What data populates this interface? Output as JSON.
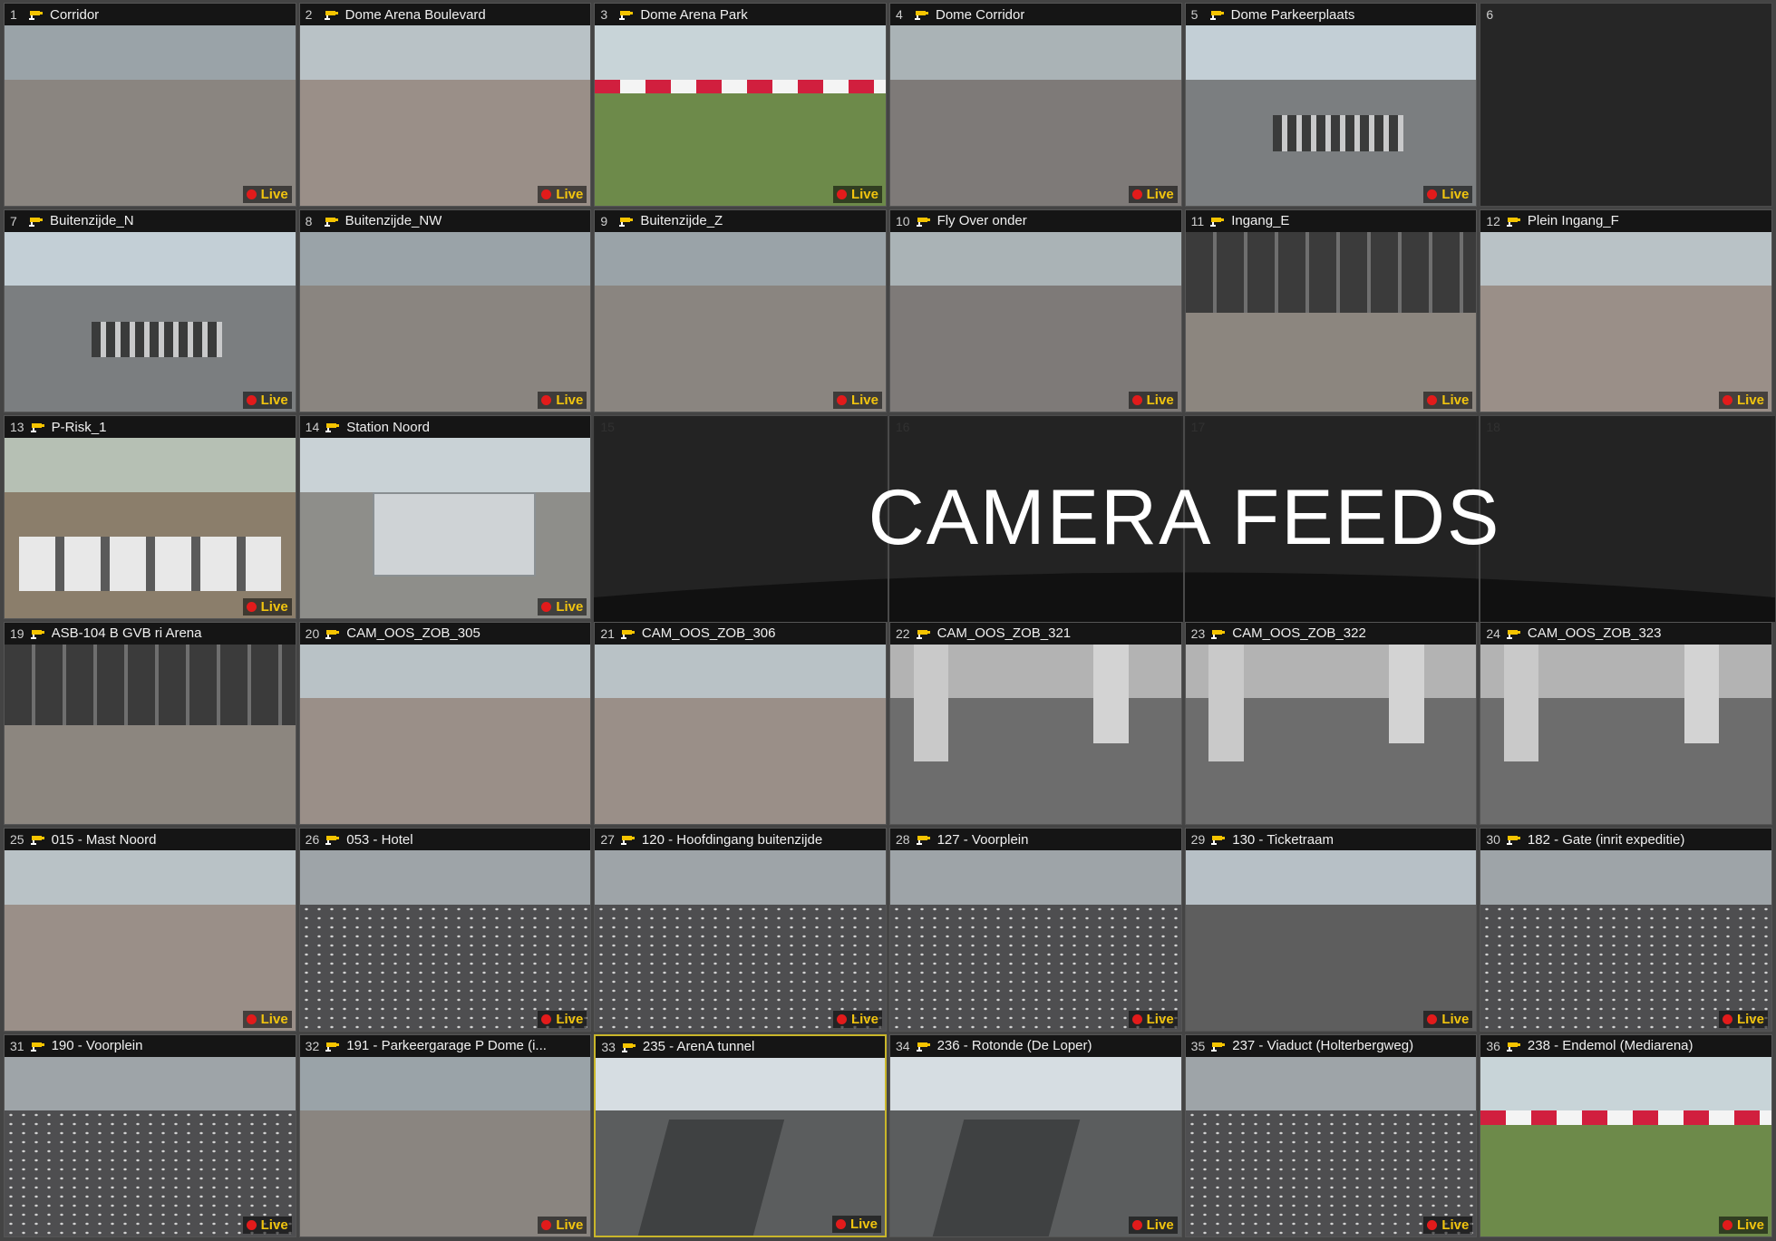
{
  "live_label": "Live",
  "colors": {
    "live_dot": "#e21b1b",
    "live_text": "#f1c40f",
    "selected_border": "#c9b62a"
  },
  "overlay_title": "CAMERA FEEDS",
  "tiles": [
    {
      "num": "1",
      "name": "Corridor",
      "live": true,
      "scene": "concrete"
    },
    {
      "num": "2",
      "name": "Dome Arena Boulevard",
      "live": true,
      "scene": "plaza"
    },
    {
      "num": "3",
      "name": "Dome Arena Park",
      "live": true,
      "scene": "park"
    },
    {
      "num": "4",
      "name": "Dome Corridor",
      "live": true,
      "scene": "walkway"
    },
    {
      "num": "5",
      "name": "Dome Parkeerplaats",
      "live": true,
      "scene": "parking"
    },
    {
      "num": "6",
      "name": "",
      "live": false,
      "scene": "empty"
    },
    {
      "num": "7",
      "name": "Buitenzijde_N",
      "live": true,
      "scene": "parking"
    },
    {
      "num": "8",
      "name": "Buitenzijde_NW",
      "live": true,
      "scene": "concrete"
    },
    {
      "num": "9",
      "name": "Buitenzijde_Z",
      "live": true,
      "scene": "concrete"
    },
    {
      "num": "10",
      "name": "Fly Over onder",
      "live": true,
      "scene": "walkway"
    },
    {
      "num": "11",
      "name": "Ingang_E",
      "live": true,
      "scene": "entrance"
    },
    {
      "num": "12",
      "name": "Plein Ingang_F",
      "live": true,
      "scene": "plaza"
    },
    {
      "num": "13",
      "name": "P-Risk_1",
      "live": true,
      "scene": "buses"
    },
    {
      "num": "14",
      "name": "Station Noord",
      "live": true,
      "scene": "station"
    },
    {
      "num": "15",
      "name": "",
      "live": false,
      "scene": "empty"
    },
    {
      "num": "16",
      "name": "",
      "live": false,
      "scene": "empty"
    },
    {
      "num": "17",
      "name": "",
      "live": false,
      "scene": "empty"
    },
    {
      "num": "18",
      "name": "",
      "live": false,
      "scene": "empty"
    },
    {
      "num": "19",
      "name": "ASB-104 B GVB ri Arena",
      "live": false,
      "scene": "entrance"
    },
    {
      "num": "20",
      "name": "CAM_OOS_ZOB_305",
      "live": false,
      "scene": "plaza"
    },
    {
      "num": "21",
      "name": "CAM_OOS_ZOB_306",
      "live": false,
      "scene": "plaza"
    },
    {
      "num": "22",
      "name": "CAM_OOS_ZOB_321",
      "live": false,
      "scene": "busstation"
    },
    {
      "num": "23",
      "name": "CAM_OOS_ZOB_322",
      "live": false,
      "scene": "busstation"
    },
    {
      "num": "24",
      "name": "CAM_OOS_ZOB_323",
      "live": false,
      "scene": "busstation"
    },
    {
      "num": "25",
      "name": "015 - Mast Noord",
      "live": true,
      "scene": "plaza"
    },
    {
      "num": "26",
      "name": "053 - Hotel",
      "live": true,
      "scene": "dotted"
    },
    {
      "num": "27",
      "name": "120 - Hoofdingang buitenzijde",
      "live": true,
      "scene": "dotted"
    },
    {
      "num": "28",
      "name": "127 - Voorplein",
      "live": true,
      "scene": "dotted"
    },
    {
      "num": "29",
      "name": "130 - Ticketraam",
      "live": true,
      "scene": "bikes"
    },
    {
      "num": "30",
      "name": "182 - Gate (inrit expeditie)",
      "live": true,
      "scene": "dotted"
    },
    {
      "num": "31",
      "name": "190 - Voorplein",
      "live": true,
      "scene": "dotted"
    },
    {
      "num": "32",
      "name": "191 - Parkeergarage P Dome (i...",
      "live": true,
      "scene": "concrete"
    },
    {
      "num": "33",
      "name": "235 - ArenA tunnel",
      "live": true,
      "scene": "road",
      "selected": true
    },
    {
      "num": "34",
      "name": "236 - Rotonde (De Loper)",
      "live": true,
      "scene": "road"
    },
    {
      "num": "35",
      "name": "237 - Viaduct (Holterbergweg)",
      "live": true,
      "scene": "dotted"
    },
    {
      "num": "36",
      "name": "238 - Endemol (Mediarena)",
      "live": true,
      "scene": "park"
    }
  ]
}
